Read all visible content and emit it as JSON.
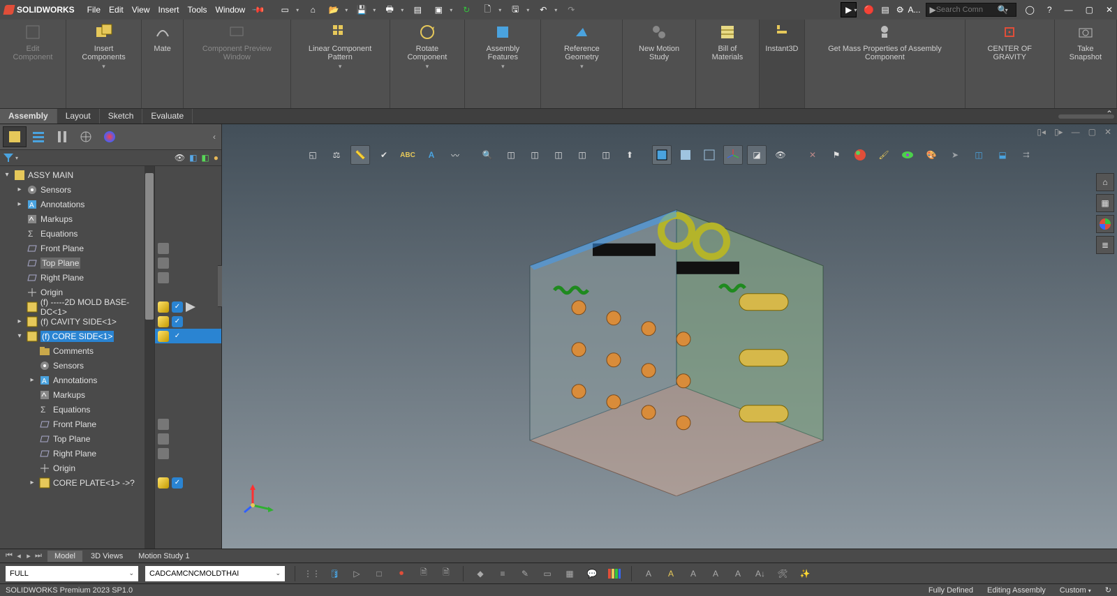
{
  "app": {
    "name": "SOLIDWORKS"
  },
  "menus": [
    "File",
    "Edit",
    "View",
    "Insert",
    "Tools",
    "Window"
  ],
  "search": {
    "placeholder": "Search Comn"
  },
  "titleRightLabel": "A...",
  "ribbon": [
    {
      "label": "Edit Component",
      "disabled": true
    },
    {
      "label": "Insert Components"
    },
    {
      "label": "Mate"
    },
    {
      "label": "Component Preview Window",
      "disabled": true
    },
    {
      "label": "Linear Component Pattern"
    },
    {
      "label": "Rotate Component"
    },
    {
      "label": "Assembly Features"
    },
    {
      "label": "Reference Geometry"
    },
    {
      "label": "New Motion Study"
    },
    {
      "label": "Bill of Materials"
    },
    {
      "label": "Instant3D",
      "active": true
    },
    {
      "label": "Get Mass Properties of Assembly Component"
    },
    {
      "label": "CENTER OF GRAVITY"
    },
    {
      "label": "Take Snapshot"
    }
  ],
  "ribbonTabs": [
    "Assembly",
    "Layout",
    "Sketch",
    "Evaluate"
  ],
  "activeRibbonTab": "Assembly",
  "tree": {
    "root": "ASSY MAIN",
    "items": [
      {
        "label": "Sensors",
        "icon": "sensor",
        "indent": 1,
        "expand": "▸"
      },
      {
        "label": "Annotations",
        "icon": "annot",
        "indent": 1,
        "expand": "▸"
      },
      {
        "label": "Markups",
        "icon": "markup",
        "indent": 1
      },
      {
        "label": "Equations",
        "icon": "eq",
        "indent": 1
      },
      {
        "label": "Front Plane",
        "icon": "plane",
        "indent": 1
      },
      {
        "label": "Top Plane",
        "icon": "plane",
        "indent": 1,
        "hl": true
      },
      {
        "label": "Right Plane",
        "icon": "plane",
        "indent": 1
      },
      {
        "label": "Origin",
        "icon": "origin",
        "indent": 1
      },
      {
        "label": "(f) -----2D MOLD BASE-DC<1>",
        "icon": "asm",
        "indent": 1
      },
      {
        "label": "(f) CAVITY SIDE<1>",
        "icon": "asm",
        "indent": 1,
        "expand": "▸"
      },
      {
        "label": "(f) CORE SIDE<1>",
        "icon": "asm",
        "indent": 1,
        "expand": "▾",
        "selected": true
      },
      {
        "label": "Comments",
        "icon": "folder",
        "indent": 2
      },
      {
        "label": "Sensors",
        "icon": "sensor",
        "indent": 2
      },
      {
        "label": "Annotations",
        "icon": "annot",
        "indent": 2,
        "expand": "▸"
      },
      {
        "label": "Markups",
        "icon": "markup",
        "indent": 2
      },
      {
        "label": "Equations",
        "icon": "eq",
        "indent": 2
      },
      {
        "label": "Front Plane",
        "icon": "plane",
        "indent": 2
      },
      {
        "label": "Top Plane",
        "icon": "plane",
        "indent": 2
      },
      {
        "label": "Right Plane",
        "icon": "plane",
        "indent": 2
      },
      {
        "label": "Origin",
        "icon": "origin",
        "indent": 2
      },
      {
        "label": "CORE PLATE<1> ->?",
        "icon": "asm",
        "indent": 2,
        "expand": "▸"
      }
    ]
  },
  "bottomTabs": [
    "Model",
    "3D Views",
    "Motion Study 1"
  ],
  "combo1": "FULL",
  "combo2": "CADCAMCNCMOLDTHAI",
  "status": {
    "left": "SOLIDWORKS Premium 2023 SP1.0",
    "fully": "Fully Defined",
    "editing": "Editing Assembly",
    "custom": "Custom"
  }
}
